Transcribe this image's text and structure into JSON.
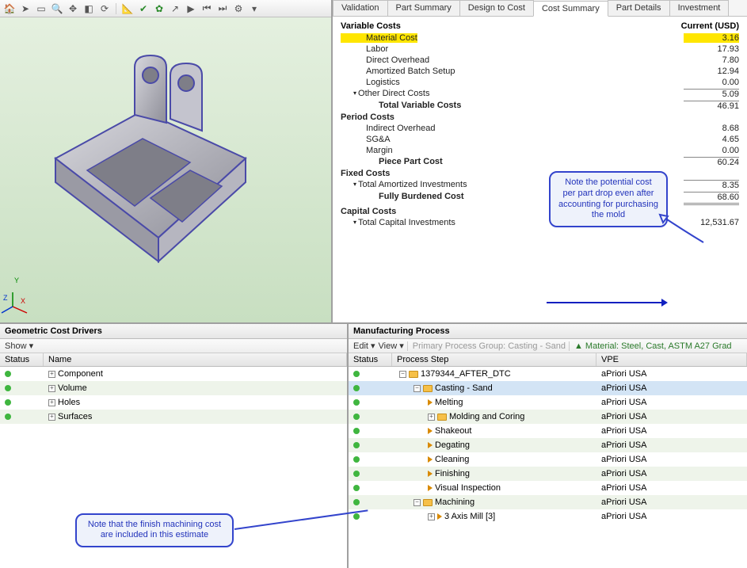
{
  "viewport": {
    "toolbar_icons": [
      "home",
      "pointer",
      "rect-select",
      "zoom-extents",
      "fit",
      "iso",
      "refresh",
      "sep",
      "measure",
      "axis",
      "leaf",
      "jump",
      "play",
      "rewind",
      "step",
      "settings",
      "dropdown"
    ]
  },
  "tabs": [
    "Validation",
    "Part Summary",
    "Design to Cost",
    "Cost Summary",
    "Part Details",
    "Investment"
  ],
  "active_tab": 3,
  "cost": {
    "header_left": "Variable Costs",
    "header_right": "Current (USD)",
    "rows": [
      {
        "k": "Material Cost",
        "v": "3.16",
        "lvl": 2,
        "hl": true
      },
      {
        "k": "Labor",
        "v": "17.93",
        "lvl": 2
      },
      {
        "k": "Direct Overhead",
        "v": "7.80",
        "lvl": 2
      },
      {
        "k": "Amortized Batch Setup",
        "v": "12.94",
        "lvl": 2
      },
      {
        "k": "Logistics",
        "v": "0.00",
        "lvl": 2
      },
      {
        "k": "Other Direct Costs",
        "v": "5.09",
        "lvl": 1,
        "caret": true,
        "bt": true
      },
      {
        "k": "Total Variable Costs",
        "v": "46.91",
        "lvl": 3,
        "bt": true
      },
      {
        "k": "Period Costs",
        "v": "",
        "lvl": 0
      },
      {
        "k": "Indirect Overhead",
        "v": "8.68",
        "lvl": 2
      },
      {
        "k": "SG&A",
        "v": "4.65",
        "lvl": 2
      },
      {
        "k": "Margin",
        "v": "0.00",
        "lvl": 2,
        "bt_after": true
      },
      {
        "k": "Piece Part Cost",
        "v": "60.24",
        "lvl": 3,
        "bt": true
      },
      {
        "k": "Fixed Costs",
        "v": "",
        "lvl": 0
      },
      {
        "k": "Total Amortized Investments",
        "v": "8.35",
        "lvl": 1,
        "caret": true,
        "bt": true
      },
      {
        "k": "Fully Burdened Cost",
        "v": "68.60",
        "lvl": 3,
        "db": true
      },
      {
        "k": "Capital Costs",
        "v": "",
        "lvl": 0
      },
      {
        "k": "Total Capital Investments",
        "v": "12,531.67",
        "lvl": 1,
        "caret": true
      }
    ]
  },
  "callout1": "Note the potential cost per part drop even after accounting for purchasing the mold",
  "callout2": "Note that the finish machining cost are included in this estimate",
  "gcd": {
    "title": "Geometric Cost Drivers",
    "menu": "Show ▾",
    "columns": [
      "Status",
      "Name"
    ],
    "rows": [
      {
        "name": "Component"
      },
      {
        "name": "Volume"
      },
      {
        "name": "Holes"
      },
      {
        "name": "Surfaces"
      }
    ]
  },
  "mp": {
    "title": "Manufacturing Process",
    "menu_edit": "Edit ▾",
    "menu_view": "View ▾",
    "ppg_label": "Primary Process Group: Casting - Sand",
    "mat_label": "Material: Steel, Cast, ASTM A27 Grad",
    "columns": [
      "Status",
      "Process Step",
      "VPE"
    ],
    "rows": [
      {
        "ind": 0,
        "exp": "minus",
        "ico": "folder",
        "name": "1379344_AFTER_DTC",
        "vpe": "aPriori USA"
      },
      {
        "ind": 1,
        "exp": "minus",
        "ico": "folder",
        "name": "Casting - Sand",
        "vpe": "aPriori USA",
        "sel": true
      },
      {
        "ind": 2,
        "exp": "",
        "ico": "proc",
        "name": "Melting",
        "vpe": "aPriori USA"
      },
      {
        "ind": 2,
        "exp": "plus",
        "ico": "folder",
        "name": "Molding and Coring",
        "vpe": "aPriori USA"
      },
      {
        "ind": 2,
        "exp": "",
        "ico": "proc",
        "name": "Shakeout",
        "vpe": "aPriori USA"
      },
      {
        "ind": 2,
        "exp": "",
        "ico": "proc",
        "name": "Degating",
        "vpe": "aPriori USA"
      },
      {
        "ind": 2,
        "exp": "",
        "ico": "proc",
        "name": "Cleaning",
        "vpe": "aPriori USA"
      },
      {
        "ind": 2,
        "exp": "",
        "ico": "proc",
        "name": "Finishing",
        "vpe": "aPriori USA"
      },
      {
        "ind": 2,
        "exp": "",
        "ico": "proc",
        "name": "Visual Inspection",
        "vpe": "aPriori USA"
      },
      {
        "ind": 1,
        "exp": "minus",
        "ico": "folder",
        "name": "Machining",
        "vpe": "aPriori USA"
      },
      {
        "ind": 2,
        "exp": "plus",
        "ico": "proc",
        "name": "3 Axis Mill [3]",
        "vpe": "aPriori USA"
      }
    ]
  }
}
